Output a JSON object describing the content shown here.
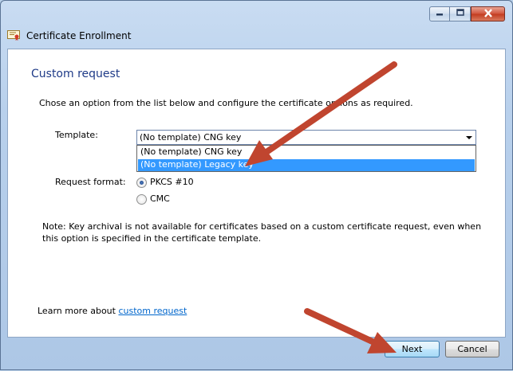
{
  "window": {
    "title": "Certificate Enrollment",
    "title_icon": "certificate-icon",
    "controls": [
      "minimize-icon",
      "maximize-icon",
      "close-icon"
    ]
  },
  "page": {
    "heading": "Custom request",
    "description": "Chose an option from the list below and configure the certificate options as required."
  },
  "template": {
    "label": "Template:",
    "selected": "(No template) CNG key",
    "options": [
      "(No template) CNG key",
      "(No template) Legacy key"
    ],
    "highlighted_index": 1
  },
  "request_format": {
    "label": "Request format:",
    "options": [
      "PKCS #10",
      "CMC"
    ],
    "selected_index": 0
  },
  "note": "Note: Key archival is not available for certificates based on a custom certificate request, even when this option is specified in the certificate template.",
  "learn_more": {
    "prefix": "Learn more about ",
    "link": "custom request"
  },
  "buttons": {
    "next": "Next",
    "cancel": "Cancel"
  },
  "colors": {
    "heading": "#1e3a87",
    "selection": "#3399ff",
    "annotation_arrow": "#c0452f",
    "link": "#0066cc"
  }
}
